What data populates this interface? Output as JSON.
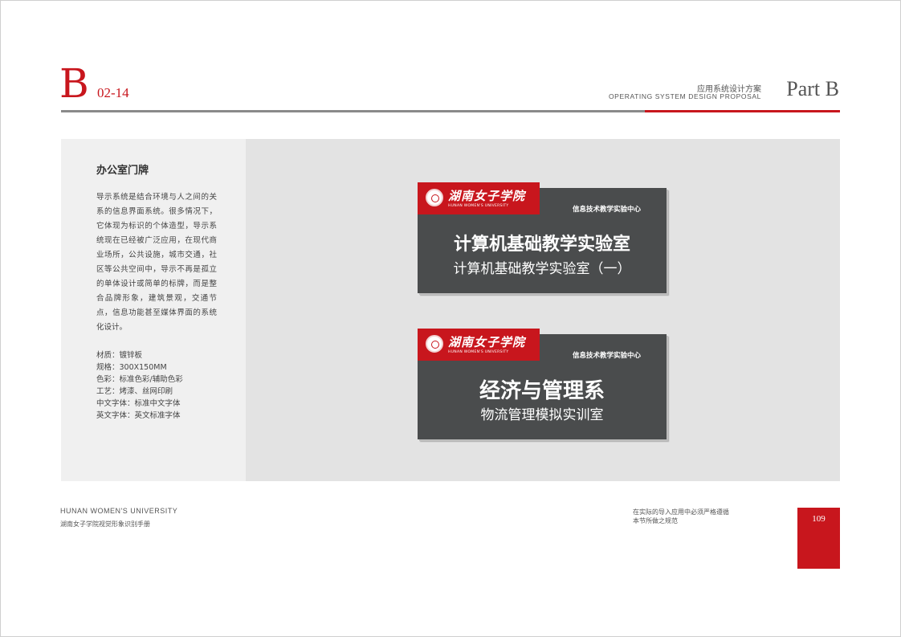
{
  "header": {
    "section_letter": "B",
    "page_code": "02-14",
    "subtitle_cn": "应用系统设计方案",
    "subtitle_en": "OPERATING SYSTEM DESIGN PROPOSAL",
    "part": "Part B"
  },
  "left_panel": {
    "title": "办公室门牌",
    "body": "导示系统是结合环境与人之间的关系的信息界面系统。很多情况下，它体现为标识的个体造型，导示系统现在已经被广泛应用，在现代商业场所，公共设施，城市交通，社区等公共空间中，导示不再是孤立的单体设计或简单的标牌，而是整合品牌形象，建筑景观，交通节点，信息功能甚至媒体界面的系统化设计。",
    "specs": [
      "材质：镀锌板",
      "规格：300X150MM",
      "色彩：标准色彩/辅助色彩",
      "工艺：烤漆、丝网印刷",
      "中文字体：标准中文字体",
      "英文字体：英文标准字体"
    ]
  },
  "signs": [
    {
      "logo_cn": "湖南女子学院",
      "logo_en": "HUNAN WOMEN'S UNIVERSITY",
      "center": "信息技术教学实验中心",
      "title": "计算机基础教学实验室",
      "subtitle": "计算机基础教学实验室（一）"
    },
    {
      "logo_cn": "湖南女子学院",
      "logo_en": "HUNAN WOMEN'S UNIVERSITY",
      "center": "信息技术教学实验中心",
      "title": "经济与管理系",
      "subtitle": "物流管理模拟实训室"
    }
  ],
  "footer": {
    "university_en": "HUNAN WOMEN'S  UNIVERSITY",
    "manual_cn": "湖南女子学院视觉形象识别手册",
    "note_line1": "在实际的导入应用中必须严格遵循",
    "note_line2": "本节所做之规范",
    "page_number": "109"
  },
  "colors": {
    "brand_red": "#c8161d",
    "sign_gray": "#4a4c4d",
    "rule_gray": "#8a8a8a"
  }
}
